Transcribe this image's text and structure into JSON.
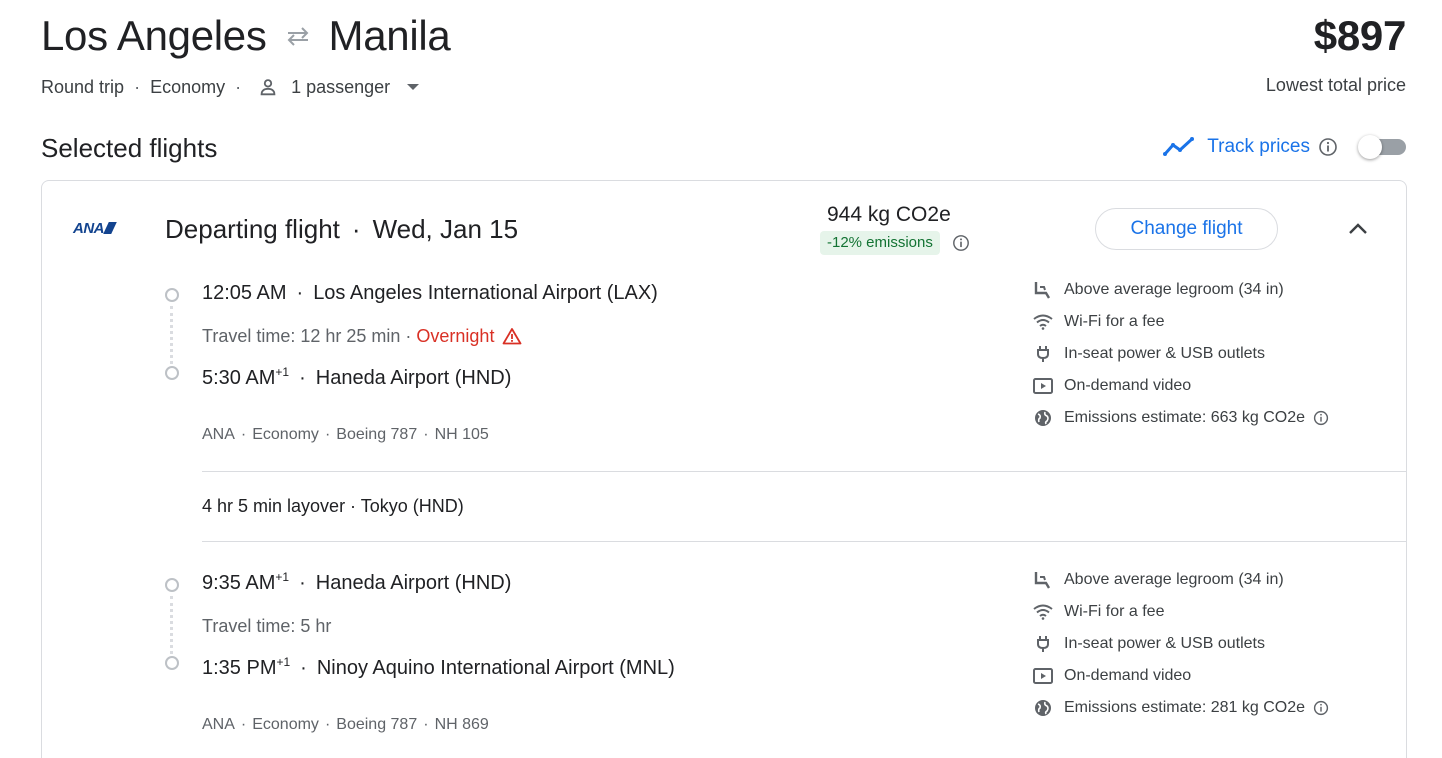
{
  "header": {
    "origin": "Los Angeles",
    "destination": "Manila",
    "price": "$897",
    "price_label": "Lowest total price",
    "trip_type": "Round trip",
    "cabin": "Economy",
    "passengers": "1 passenger"
  },
  "section": {
    "title": "Selected flights",
    "track_label": "Track prices",
    "track_enabled": false
  },
  "departing": {
    "title": "Departing flight",
    "date": "Wed, Jan 15",
    "emissions_total": "944 kg CO2e",
    "emissions_badge": "-12% emissions",
    "change_label": "Change flight",
    "segments": [
      {
        "dep_time": "12:05 AM",
        "dep_airport": "Los Angeles International Airport (LAX)",
        "travel_time": "Travel time: 12 hr 25 min",
        "overnight": "Overnight",
        "arr_time": "5:30 AM",
        "arr_plus": "+1",
        "arr_airport": "Haneda Airport (HND)",
        "airline": "ANA",
        "cabin": "Economy",
        "aircraft": "Boeing 787",
        "flight_no": "NH 105",
        "amenities": {
          "legroom": "Above average legroom (34 in)",
          "wifi": "Wi-Fi for a fee",
          "power": "In-seat power & USB outlets",
          "video": "On-demand video",
          "emissions": "Emissions estimate: 663 kg CO2e"
        }
      },
      {
        "dep_time": "9:35 AM",
        "dep_plus": "+1",
        "dep_airport": "Haneda Airport (HND)",
        "travel_time": "Travel time: 5 hr",
        "arr_time": "1:35 PM",
        "arr_plus": "+1",
        "arr_airport": "Ninoy Aquino International Airport (MNL)",
        "airline": "ANA",
        "cabin": "Economy",
        "aircraft": "Boeing 787",
        "flight_no": "NH 869",
        "amenities": {
          "legroom": "Above average legroom (34 in)",
          "wifi": "Wi-Fi for a fee",
          "power": "In-seat power & USB outlets",
          "video": "On-demand video",
          "emissions": "Emissions estimate: 281 kg CO2e"
        }
      }
    ],
    "layover": "4 hr 5 min layover · Tokyo (HND)"
  },
  "logo": {
    "text": "ANA"
  },
  "colors": {
    "accent": "#1a73e8",
    "text": "#202124",
    "secondary": "#5f6368",
    "warning": "#d93025",
    "emissions_bg": "#e6f4ea",
    "emissions_text": "#137333",
    "border": "#dadce0"
  },
  "icons": {
    "swap": "swap-arrows-icon",
    "person": "person-icon",
    "caret": "caret-down-icon",
    "track": "trend-line-icon",
    "info": "info-icon",
    "warning": "warning-icon",
    "collapse": "chevron-up-icon",
    "legroom": "seat-icon",
    "wifi": "wifi-icon",
    "power": "power-plug-icon",
    "video": "video-screen-icon",
    "emissions": "globe-icon"
  }
}
